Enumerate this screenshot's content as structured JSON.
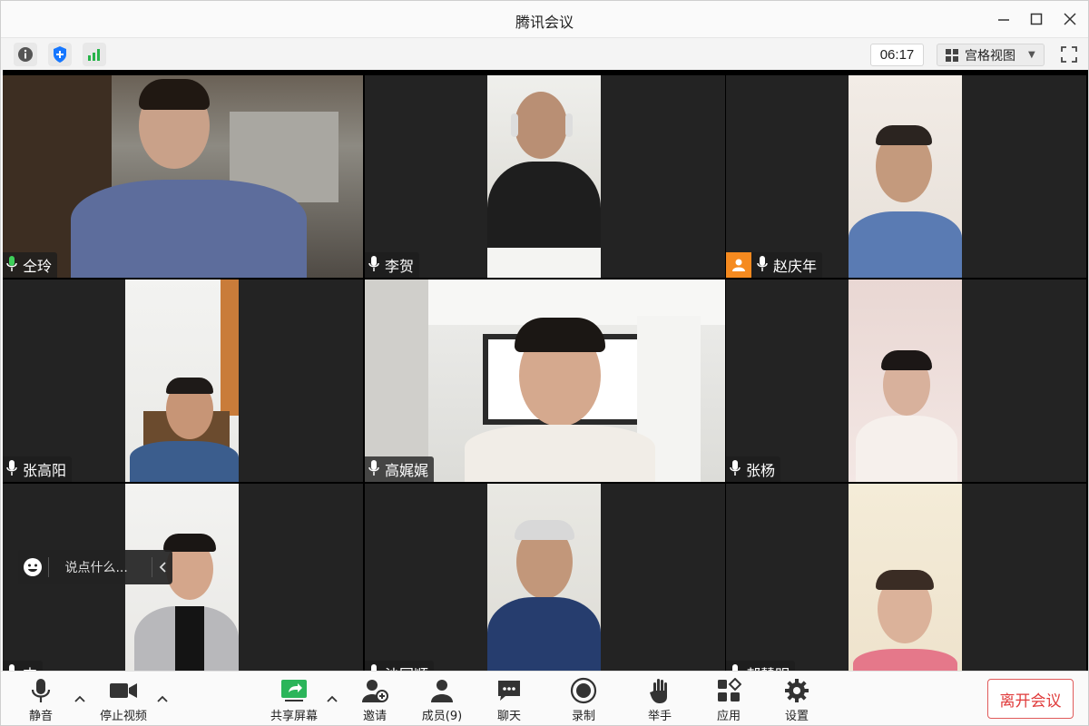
{
  "window": {
    "title": "腾讯会议"
  },
  "infobar": {
    "timer": "06:17",
    "view_mode": "宫格视图"
  },
  "participants": [
    {
      "name": "仝玲",
      "mic": "active"
    },
    {
      "name": "李贺",
      "mic": "on"
    },
    {
      "name": "赵庆年",
      "mic": "on"
    },
    {
      "name": "张高阳",
      "mic": "on"
    },
    {
      "name": "高娓娓",
      "mic": "on"
    },
    {
      "name": "张杨",
      "mic": "on"
    },
    {
      "name": "支",
      "mic": "on"
    },
    {
      "name": "沙国顺",
      "mic": "on"
    },
    {
      "name": "郝慧明",
      "mic": "on"
    }
  ],
  "chat": {
    "placeholder": "说点什么..."
  },
  "toolbar": {
    "mute": "静音",
    "stop_video": "停止视频",
    "share_screen": "共享屏幕",
    "invite": "邀请",
    "members": "成员(9)",
    "chat": "聊天",
    "record": "录制",
    "raise_hand": "举手",
    "apps": "应用",
    "settings": "设置",
    "leave": "离开会议"
  },
  "colors": {
    "active_speaker_border": "#28a745",
    "leave_red": "#e03b3b",
    "avatar_orange": "#f58a1f",
    "shield_blue": "#1677ff",
    "signal_green": "#27b34a"
  }
}
